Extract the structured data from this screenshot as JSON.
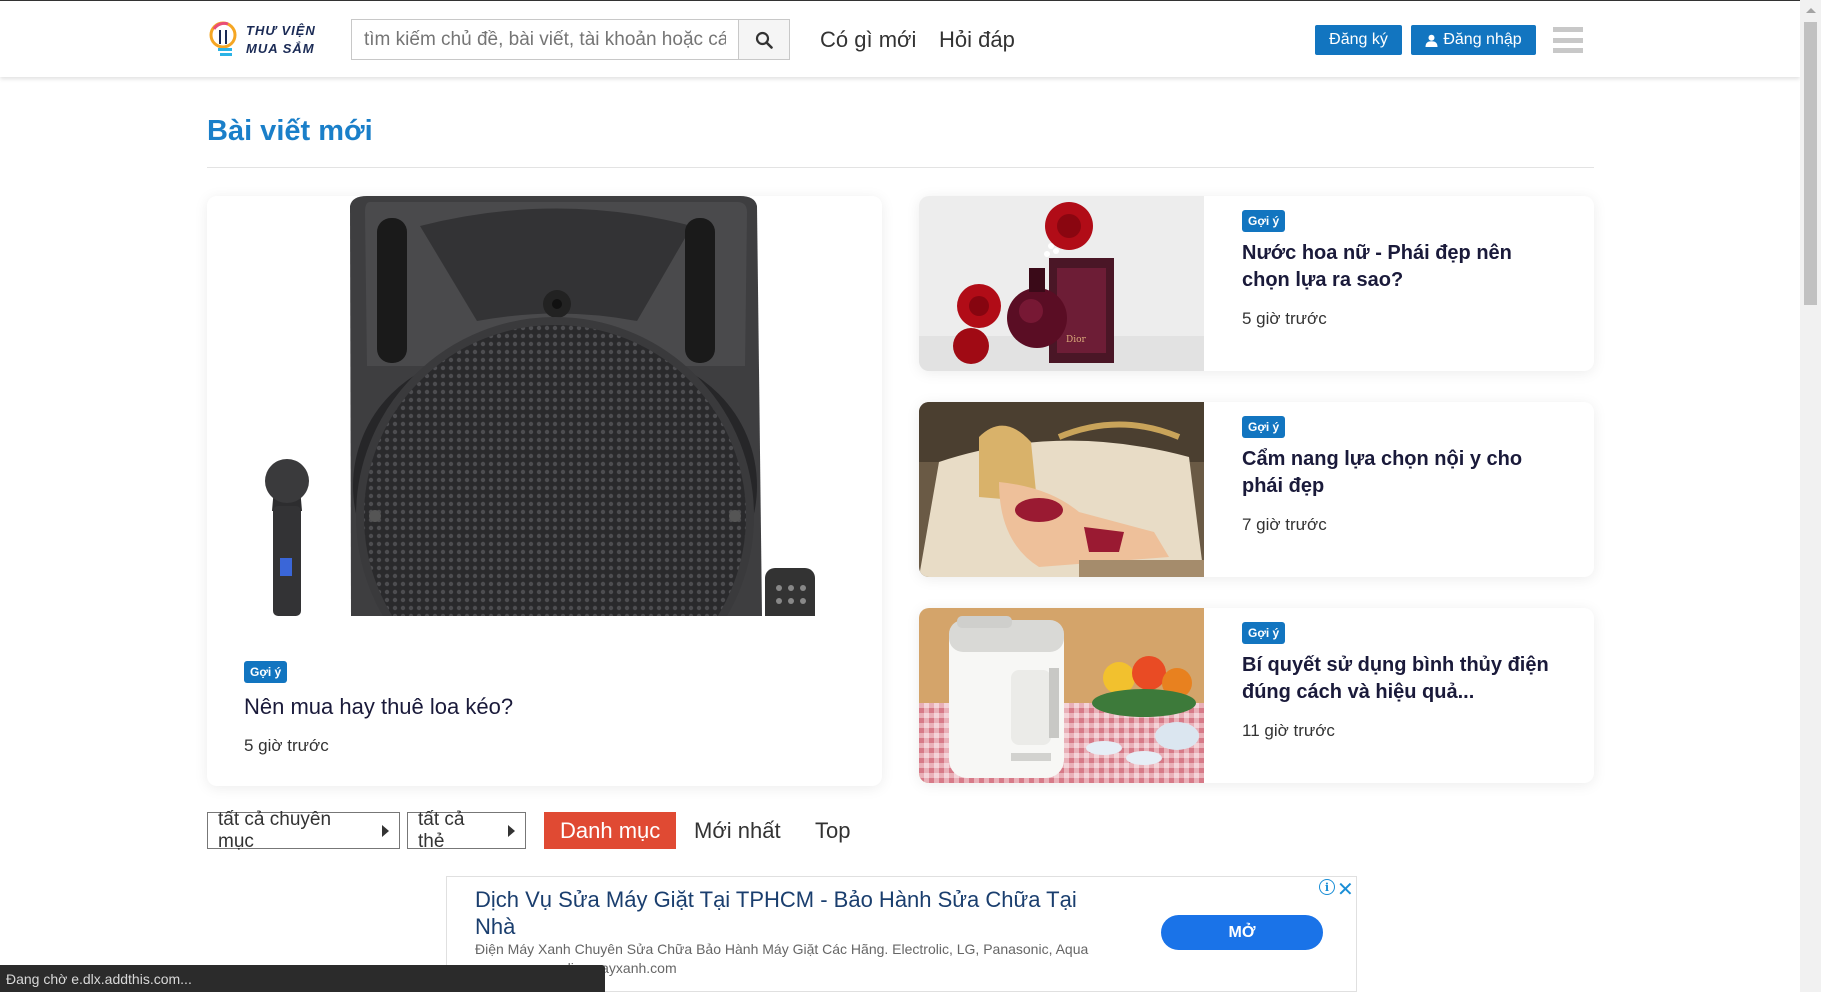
{
  "header": {
    "logo_line1": "THƯ VIỆN",
    "logo_line2": "MUA SẮM",
    "search_placeholder": "tìm kiếm chủ đề, bài viết, tài khoản hoặc cá",
    "nav": [
      "Có gì mới",
      "Hỏi đáp"
    ],
    "register_label": "Đăng ký",
    "login_label": "Đăng nhập"
  },
  "section": {
    "title": "Bài viết mới"
  },
  "featured": {
    "badge": "Gợi ý",
    "title": "Nên mua hay thuê loa kéo?",
    "time": "5 giờ trước"
  },
  "cards": [
    {
      "badge": "Gợi ý",
      "title": "Nước hoa nữ - Phái đẹp nên chọn lựa ra sao?",
      "time": "5 giờ trước"
    },
    {
      "badge": "Gợi ý",
      "title": "Cẩm nang lựa chọn nội y cho phái đẹp",
      "time": "7 giờ trước"
    },
    {
      "badge": "Gợi ý",
      "title": "Bí quyết sử dụng bình thủy điện đúng cách và hiệu quả...",
      "time": "11 giờ trước"
    }
  ],
  "filters": {
    "all_categories": "tất cả chuyên mục",
    "all_tags": "tất cả thẻ",
    "tabs": [
      "Danh mục",
      "Mới nhất",
      "Top"
    ]
  },
  "ad": {
    "title": "Dịch Vụ Sửa Máy Giặt Tại TPHCM - Bảo Hành Sửa Chữa Tại Nhà",
    "desc_line1": "Điện Máy Xanh Chuyên Sửa Chữa Bảo Hành Máy Giặt Các Hãng. Electrolic, LG, Panasonic, Aqua",
    "desc_line2": "dienmayxanh.com",
    "button": "MỞ"
  },
  "status_text": "Đang chờ e.dlx.addthis.com...",
  "colors": {
    "accent_blue": "#1275c0",
    "title_blue": "#1a7fc9",
    "active_tab": "#e04a33"
  }
}
